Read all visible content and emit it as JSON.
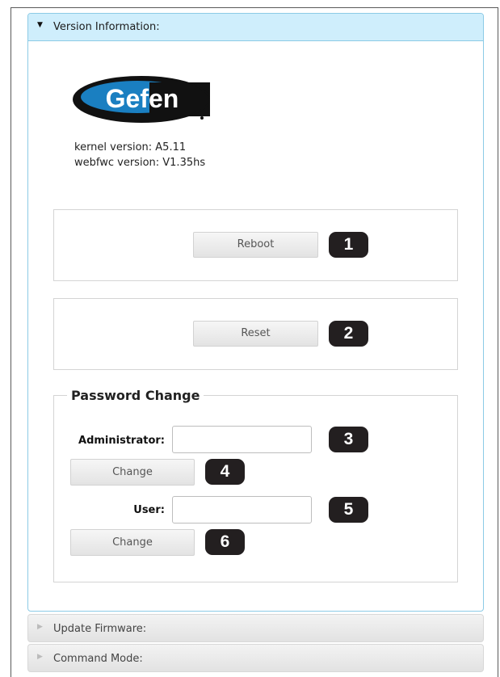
{
  "version_panel": {
    "title": "Version Information:",
    "logo_text": "Gefen",
    "kernel_version": "kernel version: A5.11",
    "webfwc_version": "webfwc version: V1.35hs"
  },
  "reboot": {
    "label": "Reboot",
    "badge": "1"
  },
  "reset": {
    "label": "Reset",
    "badge": "2"
  },
  "password_change": {
    "legend": "Password Change",
    "admin_label": "Administrator:",
    "admin_value": "",
    "admin_badge": "3",
    "admin_change_label": "Change",
    "admin_change_badge": "4",
    "user_label": "User:",
    "user_value": "",
    "user_badge": "5",
    "user_change_label": "Change",
    "user_change_badge": "6"
  },
  "collapsed_panels": [
    {
      "title": "Update Firmware:"
    },
    {
      "title": "Command Mode:"
    }
  ],
  "colors": {
    "header_bg": "#cfeefc",
    "header_border": "#8ccbe6",
    "badge_bg": "#231f20",
    "logo_blue": "#1a7fc1"
  },
  "icons": {
    "expanded_arrow": "triangle-down-icon",
    "collapsed_arrow": "triangle-right-icon"
  }
}
